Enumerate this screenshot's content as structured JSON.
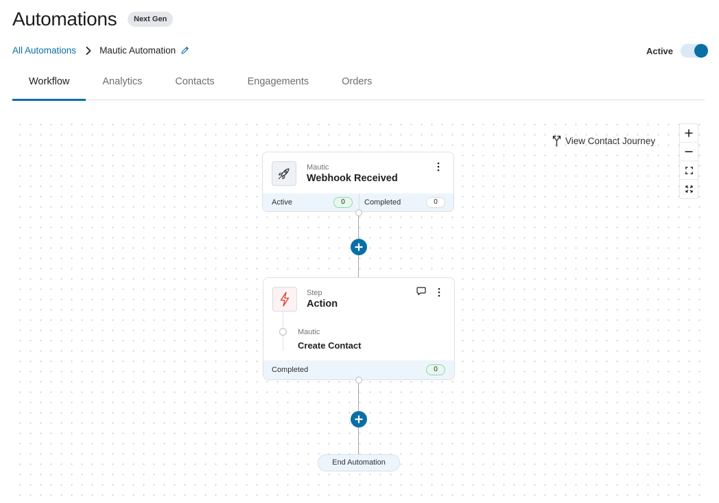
{
  "header": {
    "title": "Automations",
    "badge": "Next Gen"
  },
  "breadcrumb": {
    "root": "All Automations",
    "current": "Mautic Automation"
  },
  "status": {
    "label": "Active",
    "enabled": true,
    "accent": "#0a6fa6"
  },
  "tabs": [
    {
      "label": "Workflow",
      "active": true
    },
    {
      "label": "Analytics",
      "active": false
    },
    {
      "label": "Contacts",
      "active": false
    },
    {
      "label": "Engagements",
      "active": false
    },
    {
      "label": "Orders",
      "active": false
    }
  ],
  "canvas": {
    "journey_label": "View Contact Journey",
    "zoom_controls": [
      "plus-icon",
      "minus-icon",
      "fit-view-icon",
      "expand-icon"
    ]
  },
  "trigger_node": {
    "icon": "rocket-icon",
    "subtitle": "Mautic",
    "title": "Webhook Received",
    "active_label": "Active",
    "active_count": "0",
    "completed_label": "Completed",
    "completed_count": "0"
  },
  "action_node": {
    "icon": "lightning-icon",
    "subtitle": "Step",
    "title": "Action",
    "step_app": "Mautic",
    "step_name": "Create Contact",
    "completed_label": "Completed",
    "completed_count": "0"
  },
  "end_node": {
    "label": "End Automation"
  }
}
